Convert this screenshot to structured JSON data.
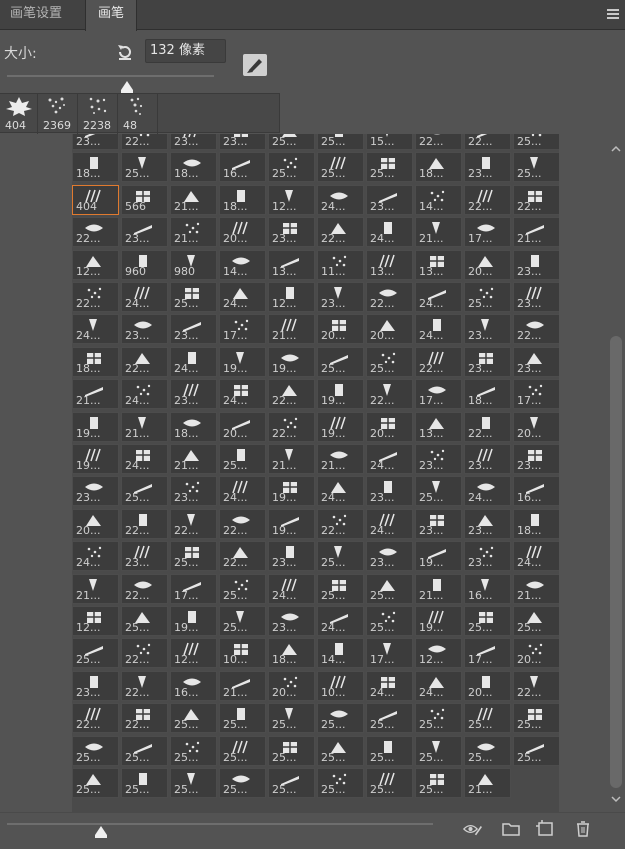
{
  "tabs": {
    "settings": "画笔设置",
    "brush": "画笔"
  },
  "size": {
    "label": "大小:",
    "value": "132 像素"
  },
  "presets": [
    {
      "num": "404"
    },
    {
      "num": "2369"
    },
    {
      "num": "2238"
    },
    {
      "num": "48"
    }
  ],
  "colors": {
    "accent": "#e07a2f",
    "panel": "#535353",
    "cell": "#3c3c3c"
  },
  "grid": {
    "selected": {
      "row": 2,
      "col": 0
    },
    "rows": [
      [
        "23...",
        "22...",
        "23...",
        "23...",
        "25...",
        "25...",
        "15...",
        "22...",
        "22...",
        "25..."
      ],
      [
        "18...",
        "25...",
        "18...",
        "16...",
        "25...",
        "25...",
        "25...",
        "18...",
        "23...",
        "25..."
      ],
      [
        "404",
        "566",
        "21...",
        "18...",
        "12...",
        "24...",
        "23...",
        "14...",
        "22...",
        "22..."
      ],
      [
        "22...",
        "23...",
        "21...",
        "20...",
        "23...",
        "22...",
        "24...",
        "21...",
        "17...",
        "21..."
      ],
      [
        "12...",
        "960",
        "980",
        "14...",
        "13...",
        "11...",
        "13...",
        "13...",
        "20...",
        "23..."
      ],
      [
        "22...",
        "24...",
        "25...",
        "24...",
        "12...",
        "23...",
        "22...",
        "24...",
        "25...",
        "23..."
      ],
      [
        "24...",
        "23...",
        "23...",
        "17...",
        "21...",
        "20...",
        "20...",
        "24...",
        "23...",
        "22..."
      ],
      [
        "18...",
        "22...",
        "24...",
        "19...",
        "19...",
        "25...",
        "25...",
        "22...",
        "23...",
        "23..."
      ],
      [
        "21...",
        "24...",
        "23...",
        "24...",
        "22...",
        "19...",
        "22...",
        "17...",
        "18...",
        "17..."
      ],
      [
        "19...",
        "21...",
        "18...",
        "20...",
        "22...",
        "19...",
        "20...",
        "13...",
        "22...",
        "20..."
      ],
      [
        "19...",
        "24...",
        "21...",
        "25...",
        "21...",
        "21...",
        "24...",
        "23...",
        "23...",
        "23..."
      ],
      [
        "23...",
        "25...",
        "23...",
        "24...",
        "19...",
        "24...",
        "23...",
        "25...",
        "24...",
        "16..."
      ],
      [
        "20...",
        "22...",
        "22...",
        "22...",
        "19...",
        "22...",
        "24...",
        "23...",
        "23...",
        "18..."
      ],
      [
        "24...",
        "23...",
        "25...",
        "22...",
        "23...",
        "25...",
        "23...",
        "19...",
        "23...",
        "24..."
      ],
      [
        "21...",
        "22...",
        "17...",
        "25...",
        "24...",
        "25...",
        "25...",
        "21...",
        "16...",
        "21..."
      ],
      [
        "12...",
        "25...",
        "19...",
        "25...",
        "23...",
        "24...",
        "25...",
        "19...",
        "25...",
        "25..."
      ],
      [
        "25...",
        "22...",
        "12...",
        "10...",
        "18...",
        "14...",
        "17...",
        "12...",
        "17...",
        "20..."
      ],
      [
        "23...",
        "22...",
        "16...",
        "21...",
        "20...",
        "10...",
        "24...",
        "24...",
        "20...",
        "22..."
      ],
      [
        "22...",
        "22...",
        "25...",
        "25...",
        "25...",
        "25...",
        "25...",
        "25...",
        "25...",
        "25..."
      ],
      [
        "25...",
        "25...",
        "25...",
        "25...",
        "25...",
        "25...",
        "25...",
        "25...",
        "25...",
        "25..."
      ],
      [
        "25...",
        "25...",
        "25...",
        "25...",
        "25...",
        "25...",
        "25...",
        "25...",
        "21...",
        ""
      ]
    ]
  }
}
